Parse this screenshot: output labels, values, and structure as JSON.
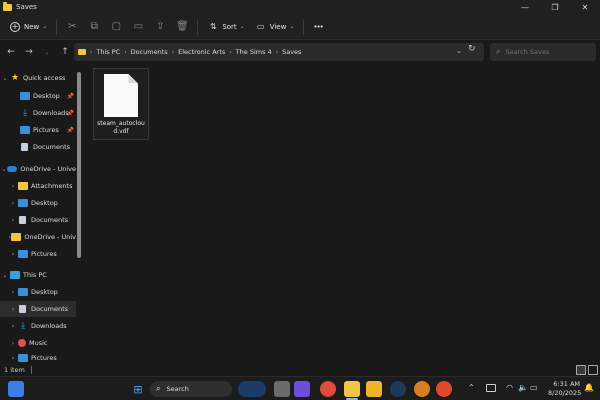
{
  "window": {
    "title": "Saves"
  },
  "toolbar": {
    "new_label": "New",
    "sort_label": "Sort",
    "view_label": "View",
    "more_label": "•••"
  },
  "address": {
    "crumbs": [
      "This PC",
      "Documents",
      "Electronic Arts",
      "The Sims 4",
      "Saves"
    ],
    "search_placeholder": "Search Saves"
  },
  "sidebar": {
    "quick_access": "Quick access",
    "qa_desktop": "Desktop",
    "qa_downloads": "Downloads",
    "qa_pictures": "Pictures",
    "qa_documents": "Documents",
    "onedrive": "OneDrive - Unive",
    "od_attachments": "Attachments",
    "od_desktop": "Desktop",
    "od_documents": "Documents",
    "od_onedrive": "OneDrive - Univ",
    "od_pictures": "Pictures",
    "this_pc": "This PC",
    "pc_desktop": "Desktop",
    "pc_documents": "Documents",
    "pc_downloads": "Downloads",
    "pc_music": "Music",
    "pc_pictures": "Pictures"
  },
  "files": [
    {
      "name": "steam_autocloud.vdf"
    }
  ],
  "status": {
    "count": "1 item"
  },
  "taskbar": {
    "search_label": "Search",
    "time": "6:31 AM",
    "date": "8/20/2025"
  }
}
